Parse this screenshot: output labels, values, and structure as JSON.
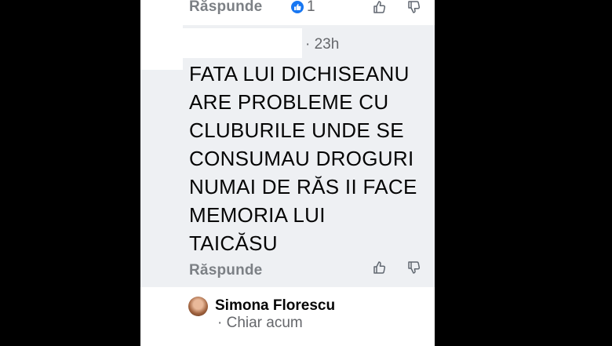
{
  "top_reply": {
    "reply_label": "Răspunde",
    "like_count": "1"
  },
  "comment": {
    "time": "· 23h",
    "text": "FATA LUI DICHISEANU\nARE PROBLEME CU\nCLUBURILE  UNDE SE\nCONSUMAU DROGURI\nNUMAI DE RĂS  II FACE\nMEMORIA LUI\nTAICĂSU",
    "reply_label": "Răspunde"
  },
  "next_comment": {
    "author": "Simona Florescu",
    "time": "· Chiar acum"
  },
  "icons": {
    "like": "like-badge-icon",
    "thumb_up": "thumbs-up-icon",
    "thumb_down": "thumbs-down-icon",
    "avatar": "avatar"
  },
  "colors": {
    "accent": "#1877f2",
    "bubble": "#eef0f3",
    "muted_text": "#65676b"
  }
}
